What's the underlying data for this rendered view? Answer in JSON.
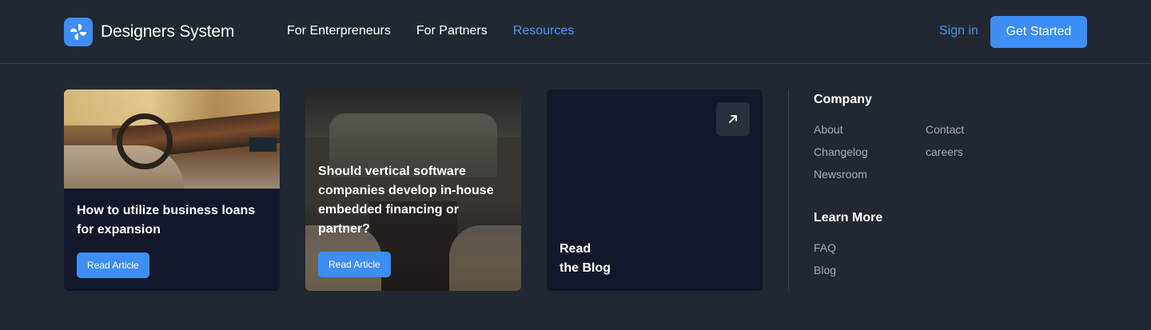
{
  "brand": {
    "name": "Designers System",
    "logo_icon": "swirl-logo-icon",
    "accent": "#3d8ef5"
  },
  "nav": [
    {
      "label": "For Enterpreneurs",
      "active": false
    },
    {
      "label": "For Partners",
      "active": false
    },
    {
      "label": "Resources",
      "active": true
    }
  ],
  "auth": {
    "signin": "Sign in",
    "cta": "Get Started"
  },
  "cards": [
    {
      "title": "How to utilize business loans for expansion",
      "button": "Read Article"
    },
    {
      "title": "Should vertical software companies develop in-house embedded financing or partner?",
      "button": "Read Article"
    }
  ],
  "blog": {
    "line1": "Read",
    "line2": "the Blog",
    "icon": "arrow-up-right-icon"
  },
  "company": {
    "title": "Company",
    "links": [
      "About",
      "Contact",
      "Changelog",
      "careers",
      "Newsroom"
    ]
  },
  "learn_more": {
    "title": "Learn More",
    "links": [
      "FAQ",
      "Blog"
    ]
  },
  "colors": {
    "background": "#222831",
    "card": "#121829",
    "link_muted": "#a4abb6",
    "active_link": "#4593f2"
  }
}
